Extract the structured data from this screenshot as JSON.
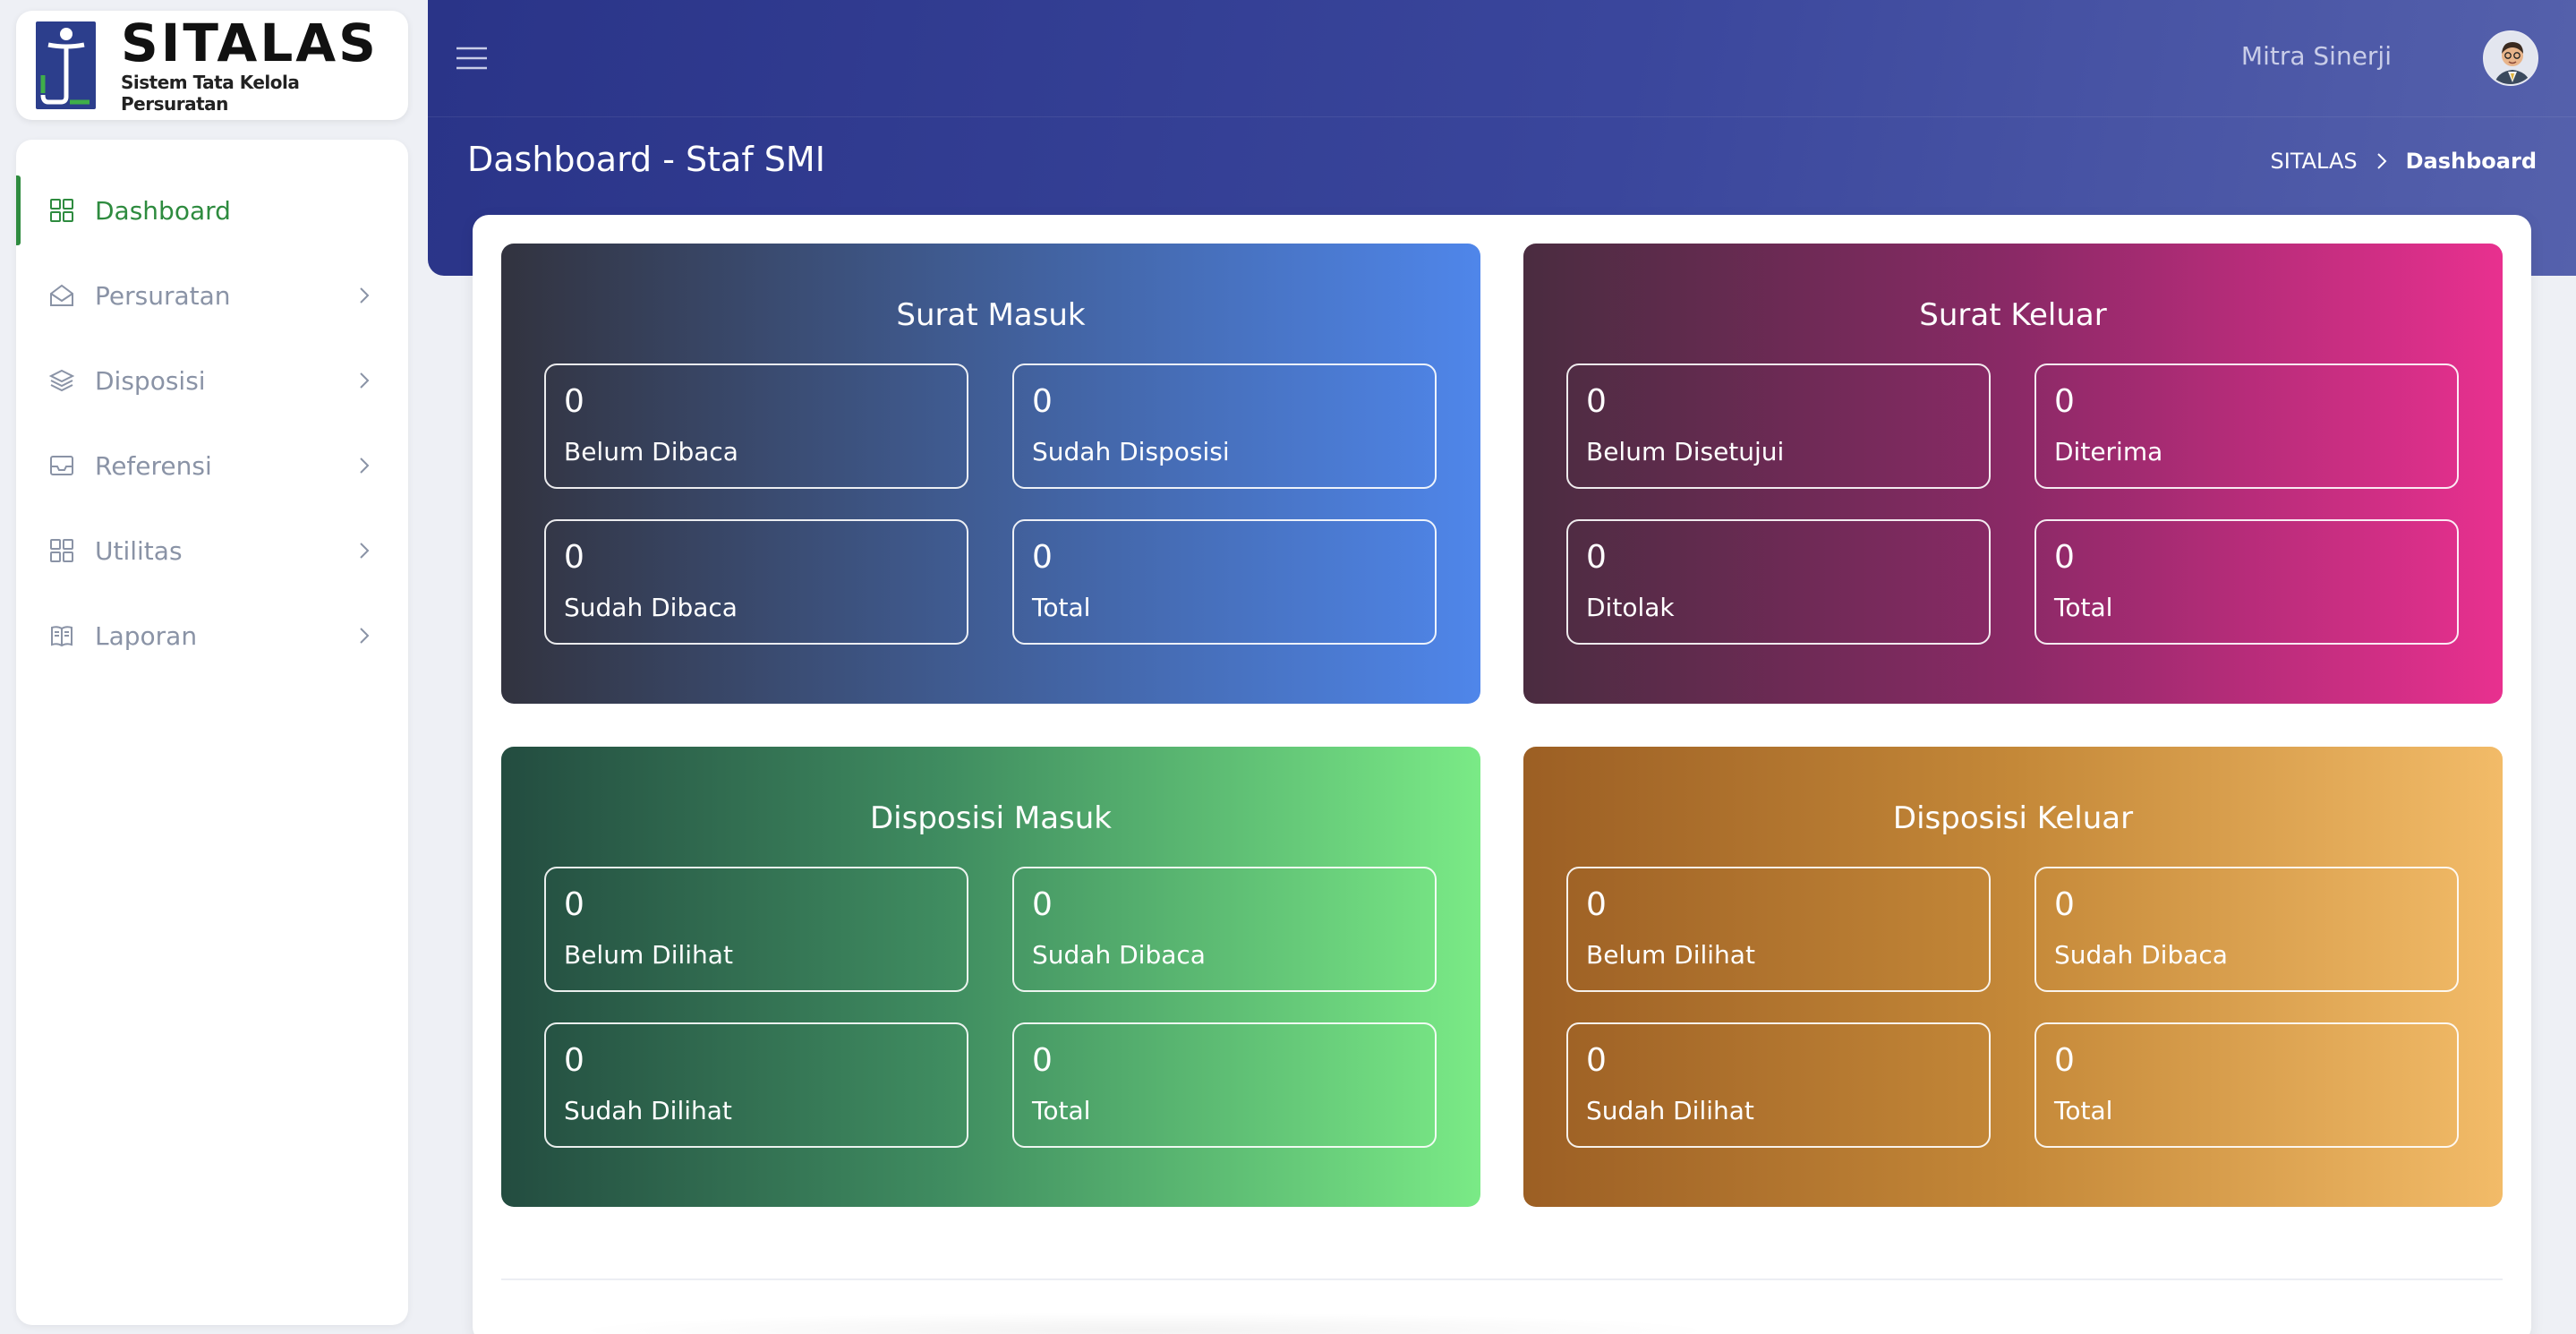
{
  "app": {
    "name": "SITALAS",
    "subtitle": "Sistem Tata Kelola Persuratan"
  },
  "sidebar": {
    "items": [
      {
        "label": "Dashboard",
        "icon": "grid-icon",
        "active": true
      },
      {
        "label": "Persuratan",
        "icon": "mail-open-icon"
      },
      {
        "label": "Disposisi",
        "icon": "layers-icon"
      },
      {
        "label": "Referensi",
        "icon": "inbox-icon"
      },
      {
        "label": "Utilitas",
        "icon": "grid-icon"
      },
      {
        "label": "Laporan",
        "icon": "book-icon"
      }
    ]
  },
  "header": {
    "user_name": "Mitra Sinerji",
    "page_title": "Dashboard - Staf SMI",
    "breadcrumb": [
      "SITALAS",
      "Dashboard"
    ]
  },
  "colors": {
    "accent_green": "#2e8b3f",
    "header_blue": "#2a3488"
  },
  "cards": [
    {
      "title": "Surat Masuk",
      "stats": [
        {
          "value": "0",
          "label": "Belum Dibaca"
        },
        {
          "value": "0",
          "label": "Sudah Disposisi"
        },
        {
          "value": "0",
          "label": "Sudah Dibaca"
        },
        {
          "value": "0",
          "label": "Total"
        }
      ]
    },
    {
      "title": "Surat Keluar",
      "stats": [
        {
          "value": "0",
          "label": "Belum Disetujui"
        },
        {
          "value": "0",
          "label": "Diterima"
        },
        {
          "value": "0",
          "label": "Ditolak"
        },
        {
          "value": "0",
          "label": "Total"
        }
      ]
    },
    {
      "title": "Disposisi Masuk",
      "stats": [
        {
          "value": "0",
          "label": "Belum Dilihat"
        },
        {
          "value": "0",
          "label": "Sudah Dibaca"
        },
        {
          "value": "0",
          "label": "Sudah Dilihat"
        },
        {
          "value": "0",
          "label": "Total"
        }
      ]
    },
    {
      "title": "Disposisi Keluar",
      "stats": [
        {
          "value": "0",
          "label": "Belum Dilihat"
        },
        {
          "value": "0",
          "label": "Sudah Dibaca"
        },
        {
          "value": "0",
          "label": "Sudah Dilihat"
        },
        {
          "value": "0",
          "label": "Total"
        }
      ]
    }
  ]
}
